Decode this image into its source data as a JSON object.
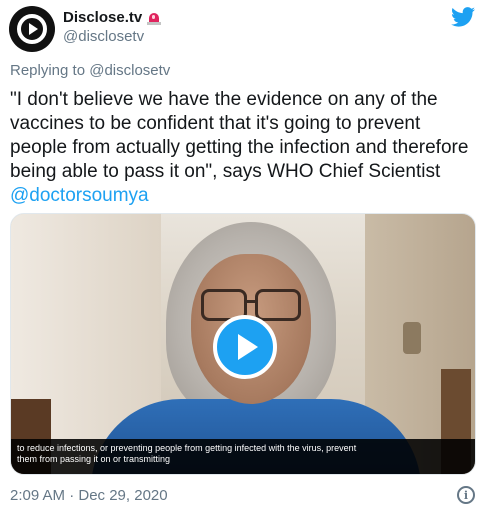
{
  "header": {
    "display_name": "Disclose.tv",
    "handle": "@disclosetv",
    "avatar_icon": "play-logo-icon",
    "badge_icon": "police-siren-icon",
    "brand_icon": "twitter-bird-icon",
    "brand_color": "#1da1f2"
  },
  "reply": {
    "prefix": "Replying to ",
    "mention": "@disclosetv"
  },
  "tweet": {
    "text": "\"I don't believe we have the evidence on any of the vaccines to be confident that it's going to prevent people from actually getting the infection and therefore being able to pass it on\", says WHO Chief Scientist ",
    "mention": "@doctorsoumya",
    "mention_color": "#1da1f2"
  },
  "video": {
    "play_icon": "play-icon",
    "caption_lines": [
      "to reduce infections, or preventing people from getting infected with the virus, prevent",
      "them from passing it on or transmitting"
    ]
  },
  "footer": {
    "timestamp": "2:09 AM · Dec 29, 2020",
    "info_icon": "info-icon"
  }
}
